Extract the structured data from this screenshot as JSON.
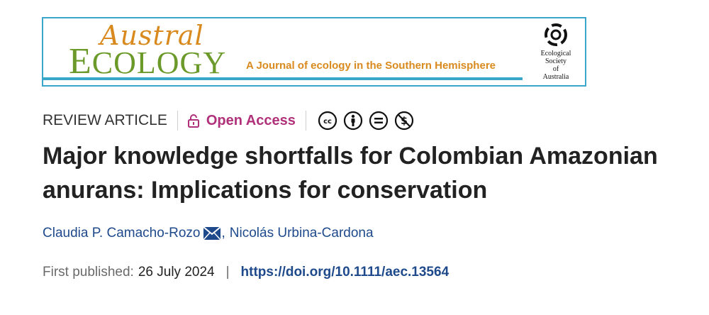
{
  "banner": {
    "logo_word1": "Austral",
    "logo_word2_initial": "E",
    "logo_word2_rest": "COLOGY",
    "tagline": "A Journal of ecology in the Southern Hemisphere",
    "society_lines": [
      "Ecological",
      "Society",
      "of",
      "Australia"
    ]
  },
  "meta": {
    "article_type": "REVIEW ARTICLE",
    "access_label": "Open Access",
    "license_icons": [
      "cc-icon",
      "by-icon",
      "nd-icon",
      "nc-icon"
    ]
  },
  "title": "Major knowledge shortfalls for Colombian Amazonian anurans: Implications for conservation",
  "authors": {
    "first": "Claudia P. Camacho-Rozo",
    "separator": ",",
    "second": "Nicolás Urbina-Cardona"
  },
  "publication": {
    "label": "First published:",
    "date": "26 July 2024",
    "divider": "|",
    "doi": "https://doi.org/10.1111/aec.13564"
  },
  "colors": {
    "banner_border": "#3aa6c9",
    "austral": "#d98a1e",
    "ecology": "#6c9a2a",
    "open_access": "#b0317a",
    "link": "#1e4a8c"
  }
}
